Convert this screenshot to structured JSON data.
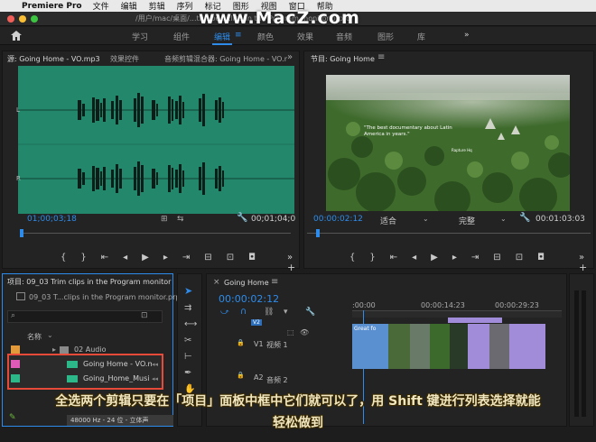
{
  "menubar": {
    "app": "Premiere Pro",
    "items": [
      "文件",
      "编辑",
      "剪辑",
      "序列",
      "标记",
      "图形",
      "视图",
      "窗口",
      "帮助"
    ]
  },
  "window": {
    "title": "/用户/mac/桌面/...th...pe...clips in the Program monitor.prproj *"
  },
  "watermark": "www.MacZ.com",
  "workspaces": [
    "学习",
    "组件",
    "编辑",
    "颜色",
    "效果",
    "音频",
    "图形",
    "库"
  ],
  "active_workspace": "编辑",
  "source": {
    "tabs": [
      "源: Going Home - VO.mp3",
      "效果控件",
      "音频剪辑混合器: Going Home - VO.r"
    ],
    "timecode": "01;00;03;18",
    "duration": "00;01;04;0",
    "channel_left": "L",
    "channel_right": "R"
  },
  "program": {
    "tab": "节目: Going Home",
    "timecode": "00:00:02:12",
    "fit": "适合",
    "quality": "完整",
    "duration": "00:01:03:03",
    "overlay_text": "\"The best documentary about Latin America in years.\"",
    "overlay_small": "Rapture Hq"
  },
  "project": {
    "tab": "项目: 09_03 Trim clips in the Program monitor",
    "file": "09_03 T...clips in the Program monitor.prproj",
    "col_name": "名称",
    "items": [
      {
        "name": "02 Audio",
        "color": "#e39a3b",
        "type": "folder"
      },
      {
        "name": "Going Home - VO.m",
        "color": "#e05ab8",
        "type": "audio"
      },
      {
        "name": "Going_Home_Musi",
        "color": "#2cb889",
        "type": "audio"
      }
    ],
    "audio_info": "48000 Hz - 24 位 - 立体声"
  },
  "timeline": {
    "tab": "Going Home",
    "timecode": "00:00:02:12",
    "ruler": [
      ":00:00",
      "00:00:14:23",
      "00:00:29:23"
    ],
    "tracks": [
      {
        "id": "V1",
        "name": "视频 1"
      },
      {
        "id": "A2",
        "name": "音频 2"
      }
    ],
    "v2_label": "V2",
    "first_clip": "Great fo"
  },
  "caption": {
    "line1": "全选两个剪辑只要在「项目」面板中框中它们就可以了，用 Shift 键进行列表选择就能",
    "line2": "轻松做到"
  },
  "colors": {
    "accent": "#2d8ceb",
    "source_wave_bg": "#23876b",
    "clip_purple": "#a08cd8",
    "highlight_box": "#e84a3a"
  }
}
